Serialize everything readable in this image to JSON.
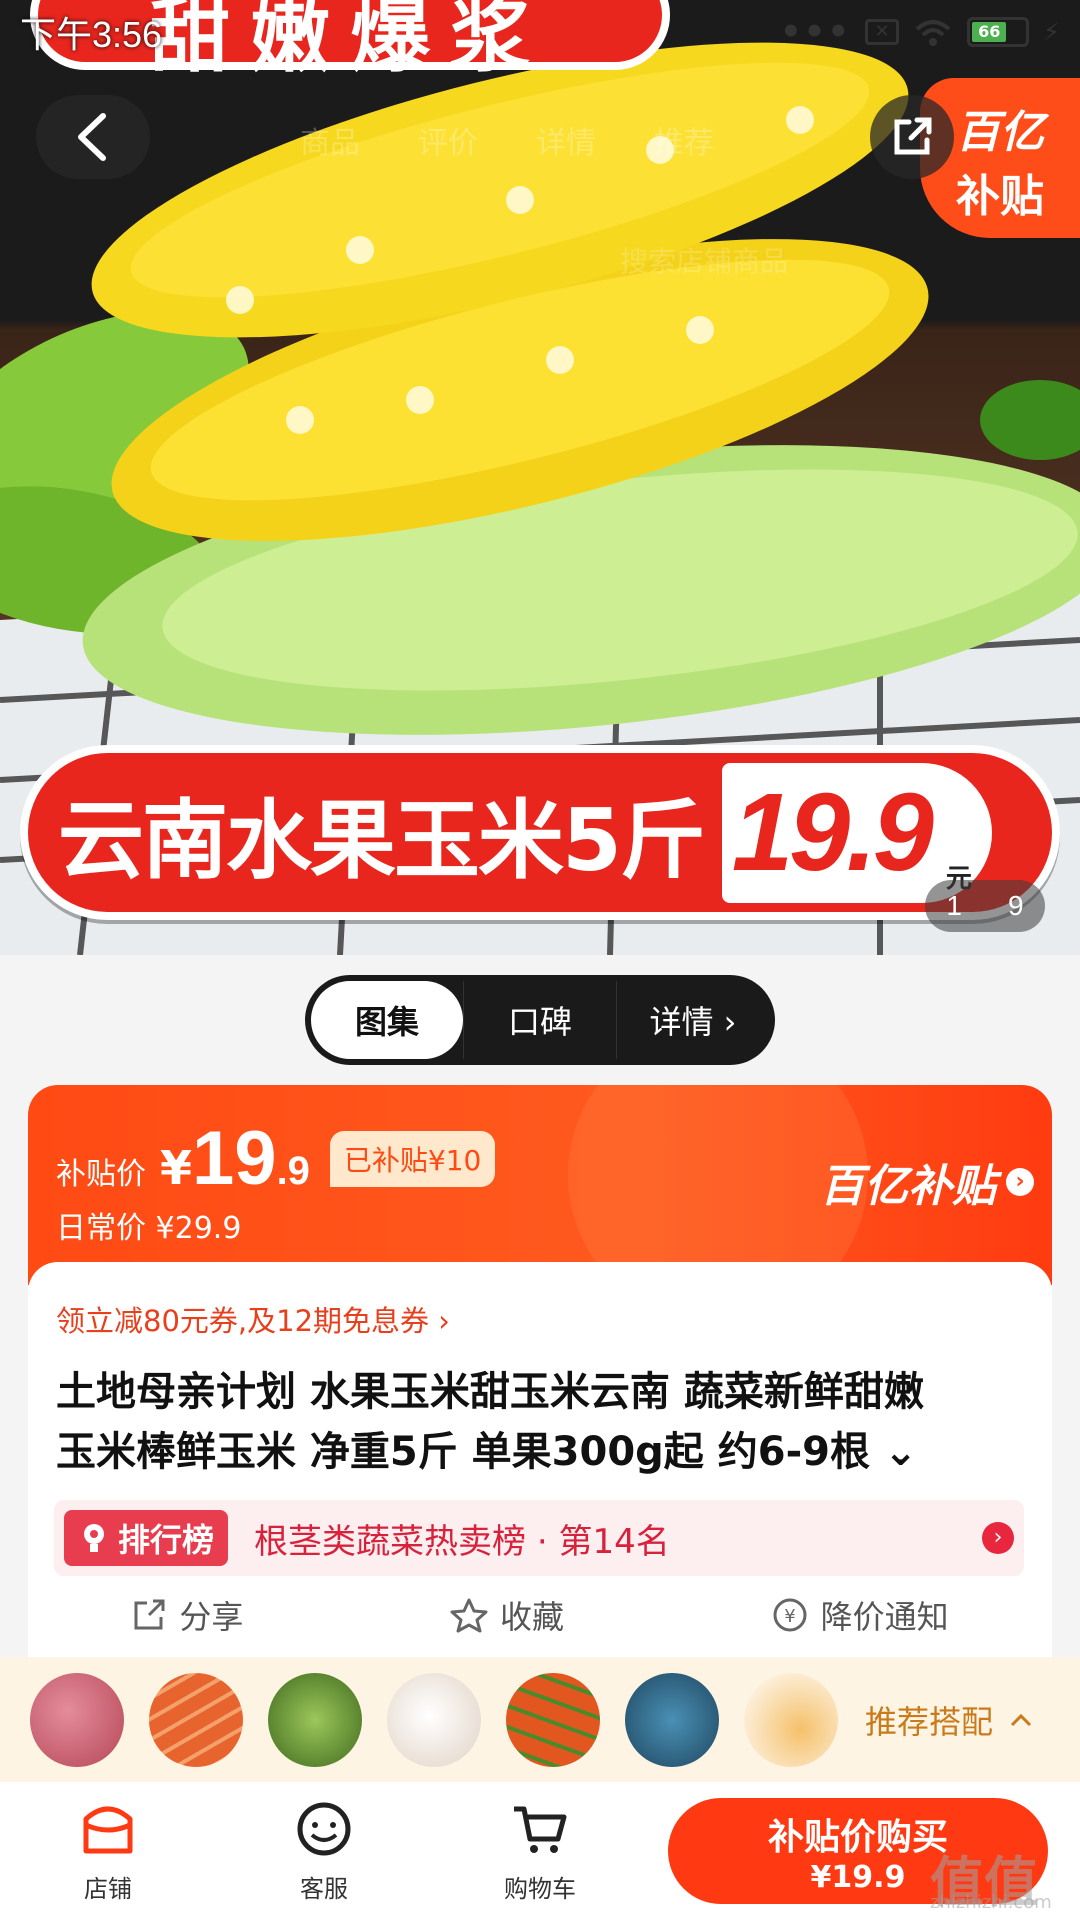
{
  "status_bar": {
    "time": "下午3:56",
    "dots": "•••",
    "battery_level": "66"
  },
  "hero": {
    "top_banner": "甜嫩爆浆",
    "ghost_tabs": [
      "商品",
      "评价",
      "详情",
      "推荐"
    ],
    "ghost_search": "搜索店铺商品",
    "brand_line1": "百亿",
    "brand_line2": "补贴",
    "banner_title": "云南水果玉米5斤",
    "banner_price": "19.9",
    "banner_unit": "元",
    "pager_current": "1",
    "pager_total": "9"
  },
  "segments": [
    {
      "label": "图集",
      "active": true
    },
    {
      "label": "口碑",
      "active": false
    },
    {
      "label": "详情 ›",
      "active": false
    }
  ],
  "price_card": {
    "label": "补贴价",
    "currency": "¥",
    "price_int": "19",
    "price_dec": ".9",
    "subsidy_tag": "已补贴¥10",
    "regular_label": "日常价 ¥29.9",
    "brand": "百亿补贴",
    "brand_arrow": "›"
  },
  "info": {
    "coupon": "领立减80元券,及12期免息券 ›",
    "title_line1": "土地母亲计划 水果玉米甜玉米云南 蔬菜新鲜甜嫩",
    "title_line2": "玉米棒鲜玉米 净重5斤 单果300g起  约6-9根 ⌄",
    "rank_badge": "排行榜",
    "rank_text": "根茎类蔬菜热卖榜 · 第14名",
    "rank_arrow": "›",
    "actions": {
      "share": "分享",
      "favorite": "收藏",
      "price_alert": "降价通知"
    }
  },
  "reco": {
    "label": "推荐搭配",
    "thumbs": [
      "#b5475a",
      "#d9532f",
      "#5a7a2a",
      "#e8e0d8",
      "#d8501e",
      "#2a5a7a",
      "#f2b248"
    ]
  },
  "bottom_bar": {
    "store": "店铺",
    "service": "客服",
    "cart": "购物车",
    "buy_line1": "补贴价购买",
    "buy_line2": "¥19.9"
  },
  "watermark": {
    "main": "值值值",
    "sub": "zhizhizhi.com"
  },
  "colors": {
    "accent": "#ff4a14",
    "banner_red": "#e8261e",
    "rank_red": "#e83c4f"
  }
}
